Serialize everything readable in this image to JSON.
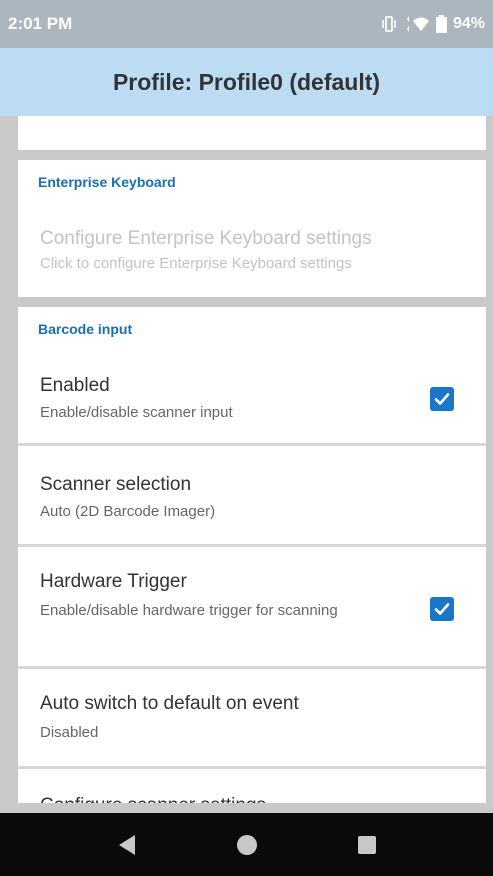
{
  "status_bar": {
    "time": "2:01 PM",
    "battery_percent": "94%",
    "icons": [
      "vibrate-icon",
      "wifi-icon",
      "battery-icon"
    ]
  },
  "app_bar": {
    "title": "Profile: Profile0 (default)"
  },
  "sections": {
    "enterprise_keyboard": {
      "title": "Enterprise Keyboard",
      "configure": {
        "title": "Configure Enterprise Keyboard settings",
        "subtitle": "Click to configure Enterprise Keyboard settings"
      }
    },
    "barcode_input": {
      "title": "Barcode input",
      "items": [
        {
          "title": "Enabled",
          "subtitle": "Enable/disable scanner input",
          "checked": true
        },
        {
          "title": "Scanner selection",
          "subtitle": "Auto (2D Barcode Imager)"
        },
        {
          "title": "Hardware Trigger",
          "subtitle": "Enable/disable hardware trigger for scanning",
          "checked": true
        },
        {
          "title": "Auto switch to default on event",
          "subtitle": "Disabled"
        },
        {
          "title": "Configure scanner settings"
        }
      ]
    }
  },
  "colors": {
    "accent": "#1976c8",
    "section_title": "#1a6fb0",
    "app_bar": "#bcdcf4",
    "status_bar": "#acb6bf"
  },
  "nav_bar": {
    "icons": [
      "back-icon",
      "home-icon",
      "recents-icon"
    ]
  }
}
